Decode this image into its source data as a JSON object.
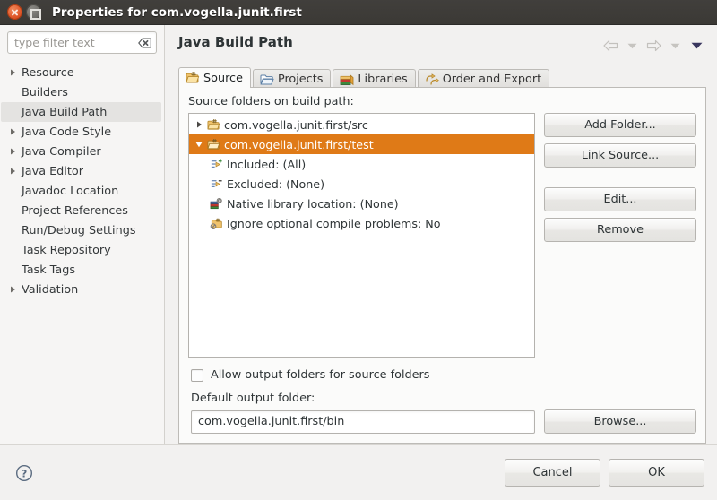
{
  "window": {
    "title": "Properties for com.vogella.junit.first",
    "close_icon": "close-icon",
    "maximize_icon": "maximize-icon"
  },
  "sidebar": {
    "filter": {
      "placeholder": "type filter text",
      "value": "",
      "clear_icon": "clear-icon"
    },
    "items": [
      {
        "label": "Resource",
        "expandable": true,
        "selected": false
      },
      {
        "label": "Builders",
        "expandable": false,
        "selected": false
      },
      {
        "label": "Java Build Path",
        "expandable": false,
        "selected": true
      },
      {
        "label": "Java Code Style",
        "expandable": true,
        "selected": false
      },
      {
        "label": "Java Compiler",
        "expandable": true,
        "selected": false
      },
      {
        "label": "Java Editor",
        "expandable": true,
        "selected": false
      },
      {
        "label": "Javadoc Location",
        "expandable": false,
        "selected": false
      },
      {
        "label": "Project References",
        "expandable": false,
        "selected": false
      },
      {
        "label": "Run/Debug Settings",
        "expandable": false,
        "selected": false
      },
      {
        "label": "Task Repository",
        "expandable": false,
        "selected": false
      },
      {
        "label": "Task Tags",
        "expandable": false,
        "selected": false
      },
      {
        "label": "Validation",
        "expandable": true,
        "selected": false
      }
    ]
  },
  "page": {
    "title": "Java Build Path",
    "nav": {
      "back_icon": "back-arrow-icon",
      "back_menu_icon": "chevron-down-icon",
      "forward_icon": "forward-arrow-icon",
      "forward_menu_icon": "chevron-down-icon",
      "view_menu_icon": "chevron-down-icon"
    }
  },
  "tabs": [
    {
      "label": "Source",
      "icon": "source-folder-icon",
      "active": true
    },
    {
      "label": "Projects",
      "icon": "open-folder-icon",
      "active": false
    },
    {
      "label": "Libraries",
      "icon": "books-icon",
      "active": false
    },
    {
      "label": "Order and Export",
      "icon": "order-arrows-icon",
      "active": false
    }
  ],
  "source_tab": {
    "list_label": "Source folders on build path:",
    "entries": [
      {
        "label": "com.vogella.junit.first/src",
        "icon": "source-folder-icon",
        "twisty": "collapsed",
        "selected": false,
        "child": false
      },
      {
        "label": "com.vogella.junit.first/test",
        "icon": "source-folder-icon",
        "twisty": "expanded",
        "selected": true,
        "child": false
      },
      {
        "label": "Included: (All)",
        "icon": "include-filter-icon",
        "twisty": "none",
        "selected": false,
        "child": true
      },
      {
        "label": "Excluded: (None)",
        "icon": "exclude-filter-icon",
        "twisty": "none",
        "selected": false,
        "child": true
      },
      {
        "label": "Native library location: (None)",
        "icon": "native-library-icon",
        "twisty": "none",
        "selected": false,
        "child": true
      },
      {
        "label": "Ignore optional compile problems: No",
        "icon": "ignore-problems-icon",
        "twisty": "none",
        "selected": false,
        "child": true
      }
    ],
    "buttons": {
      "add_folder": "Add Folder...",
      "link_source": "Link Source...",
      "edit": "Edit...",
      "remove": "Remove"
    },
    "allow_output_checkbox": {
      "label": "Allow output folders for source folders",
      "checked": false
    },
    "default_output_label": "Default output folder:",
    "default_output_value": "com.vogella.junit.first/bin",
    "browse_button": "Browse..."
  },
  "footer": {
    "help_icon": "help-icon",
    "cancel": "Cancel",
    "ok": "OK"
  },
  "colors": {
    "selection_orange": "#df7a17",
    "titlebar": "#3b3935",
    "close_button": "#e0582b",
    "sidebar_selected": "#e4e3e1"
  }
}
